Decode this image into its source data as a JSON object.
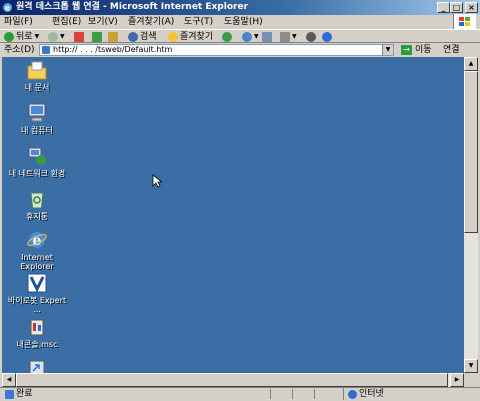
{
  "window": {
    "title": "원격 데스크톱 웹 연결 - Microsoft Internet Explorer",
    "controls": {
      "minimize": "_",
      "maximize": "□",
      "close": "×"
    }
  },
  "menu": [
    {
      "label": "파일(F)"
    },
    {
      "label": "편집(E)"
    },
    {
      "label": "보기(V)"
    },
    {
      "label": "즐겨찾기(A)"
    },
    {
      "label": "도구(T)"
    },
    {
      "label": "도움말(H)"
    }
  ],
  "toolbar": {
    "back_label": "뒤로",
    "search_label": "검색",
    "favorites_label": "즐겨찾기"
  },
  "address": {
    "label": "주소(D)",
    "url": "http://       .  .  .     /tsweb/Default.htm",
    "go_label": "이동",
    "links_label": "연결"
  },
  "desktop": {
    "icons": [
      {
        "label": "내 문서",
        "icon": "my-documents-icon"
      },
      {
        "label": "내 컴퓨터",
        "icon": "my-computer-icon"
      },
      {
        "label": "내 네트워크 환경",
        "icon": "network-places-icon"
      },
      {
        "label": "휴지통",
        "icon": "recycle-bin-icon"
      },
      {
        "label": "Internet Explorer",
        "icon": "internet-explorer-icon"
      },
      {
        "label": "바이로봇 Expert ...",
        "icon": "virobot-icon"
      },
      {
        "label": "내콘솔.msc",
        "icon": "msc-console-icon"
      },
      {
        "label": "",
        "icon": "shortcut-icon"
      }
    ],
    "background": "#3a6ea5"
  },
  "status": {
    "text": "완료",
    "zone": "인터넷"
  }
}
